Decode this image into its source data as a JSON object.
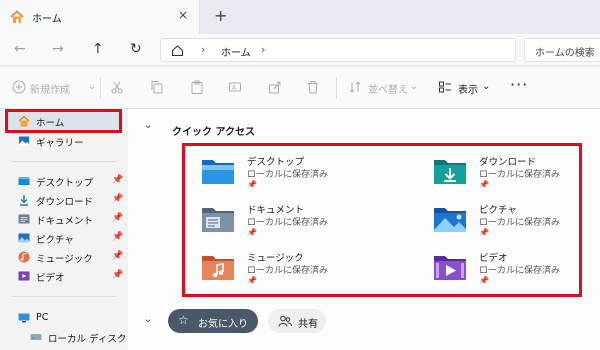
{
  "tab": {
    "title": "ホーム",
    "close": "×",
    "new": "+"
  },
  "nav": {
    "back": "←",
    "forward": "→",
    "up": "↑",
    "refresh": "↻"
  },
  "address": {
    "sep": "›",
    "crumb": "ホーム"
  },
  "search": {
    "placeholder": "ホームの検索"
  },
  "toolbar": {
    "new_label": "新規作成",
    "sort_label": "並べ替え",
    "view_label": "表示",
    "more": "···"
  },
  "sidebar": {
    "items": [
      {
        "label": "ホーム"
      },
      {
        "label": "ギャラリー"
      },
      {
        "label": "デスクトップ"
      },
      {
        "label": "ダウンロード"
      },
      {
        "label": "ドキュメント"
      },
      {
        "label": "ピクチャ"
      },
      {
        "label": "ミュージック"
      },
      {
        "label": "ビデオ"
      },
      {
        "label": "PC"
      },
      {
        "label": "ローカル ディスク (C:)"
      }
    ],
    "pin": "📌"
  },
  "main": {
    "quick_access_title": "クイック アクセス",
    "chevron": "⌄",
    "items": [
      {
        "name": "デスクトップ",
        "sub": "ローカルに保存済み",
        "pin": "📌"
      },
      {
        "name": "ダウンロード",
        "sub": "ローカルに保存済み",
        "pin": "📌"
      },
      {
        "name": "ドキュメント",
        "sub": "ローカルに保存済み",
        "pin": "📌"
      },
      {
        "name": "ピクチャ",
        "sub": "ローカルに保存済み",
        "pin": "📌"
      },
      {
        "name": "ミュージック",
        "sub": "ローカルに保存済み",
        "pin": "📌"
      },
      {
        "name": "ビデオ",
        "sub": "ローカルに保存済み",
        "pin": "📌"
      }
    ],
    "favorites_label": "お気に入り",
    "favorites_star": "☆",
    "shared_label": "共有"
  },
  "colors": {
    "highlight": "#e00b1c",
    "accent": "#0067c0",
    "pill_active": "#4a5968"
  }
}
